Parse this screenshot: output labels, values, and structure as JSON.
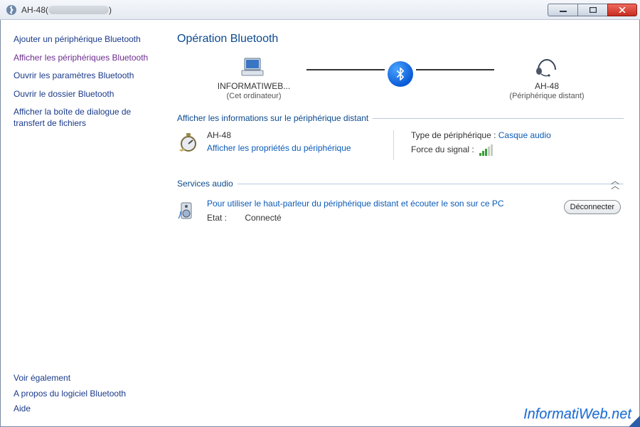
{
  "window": {
    "title_prefix": "AH-48(",
    "title_suffix": ")"
  },
  "sidebar": {
    "links": [
      "Ajouter un périphérique Bluetooth",
      "Afficher les périphériques Bluetooth",
      "Ouvrir les paramètres Bluetooth",
      "Ouvrir le dossier Bluetooth",
      "Afficher la boîte de dialogue de transfert de fichiers"
    ],
    "see_also": "Voir également",
    "footer": [
      "A propos du logiciel Bluetooth",
      "Aide"
    ]
  },
  "page": {
    "title": "Opération Bluetooth",
    "local": {
      "name": "INFORMATIWEB...",
      "sub": "(Cet ordinateur)"
    },
    "remote": {
      "name": "AH-48",
      "sub": "(Périphérique distant)"
    }
  },
  "info_group": {
    "title": "Afficher les informations sur le périphérique distant",
    "device_name": "AH-48",
    "properties_link": "Afficher les propriétés du périphérique",
    "type_label": "Type de périphérique :",
    "type_value": "Casque audio",
    "signal_label": "Force du signal :"
  },
  "services_group": {
    "title": "Services audio",
    "desc": "Pour utiliser le haut-parleur du périphérique distant et écouter le son sur ce PC",
    "state_label": "Etat :",
    "state_value": "Connecté",
    "disconnect": "Déconnecter"
  },
  "watermark": "InformatiWeb.net"
}
